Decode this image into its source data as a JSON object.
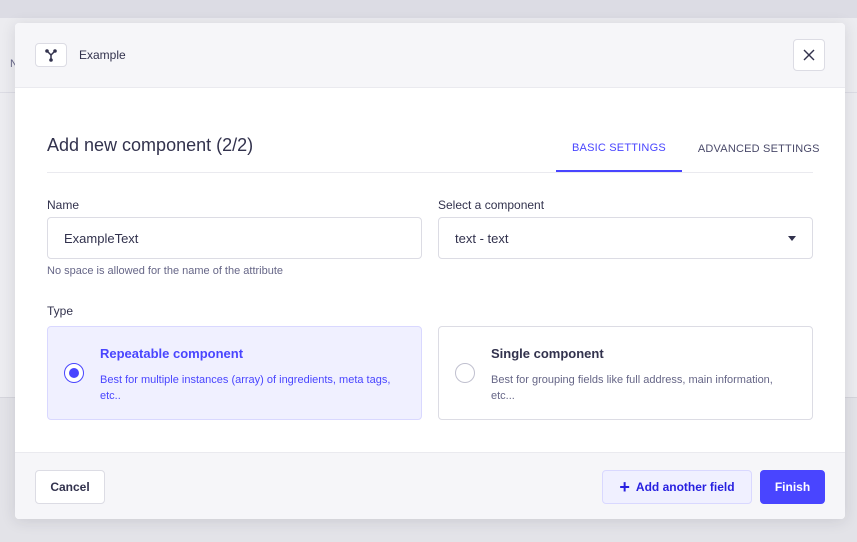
{
  "background": {
    "letter": "N"
  },
  "header": {
    "title": "Example",
    "icon": "component-icon",
    "close_icon": "close-icon"
  },
  "title": "Add new component (2/2)",
  "tabs": [
    {
      "label": "BASIC SETTINGS",
      "active": true
    },
    {
      "label": "ADVANCED SETTINGS",
      "active": false
    }
  ],
  "form": {
    "name_label": "Name",
    "name_value": "ExampleText",
    "name_hint": "No space is allowed for the name of the attribute",
    "component_label": "Select a component",
    "component_value": "text - text",
    "type_label": "Type",
    "types": [
      {
        "title": "Repeatable component",
        "description": "Best for multiple instances (array) of ingredients, meta tags, etc..",
        "selected": true
      },
      {
        "title": "Single component",
        "description": "Best for grouping fields like full address, main information, etc...",
        "selected": false
      }
    ]
  },
  "footer": {
    "cancel_label": "Cancel",
    "add_label": "Add another field",
    "finish_label": "Finish"
  },
  "colors": {
    "primary": "#4945ff",
    "primary_light": "#f0f0ff",
    "text": "#32324d",
    "muted": "#666687"
  }
}
